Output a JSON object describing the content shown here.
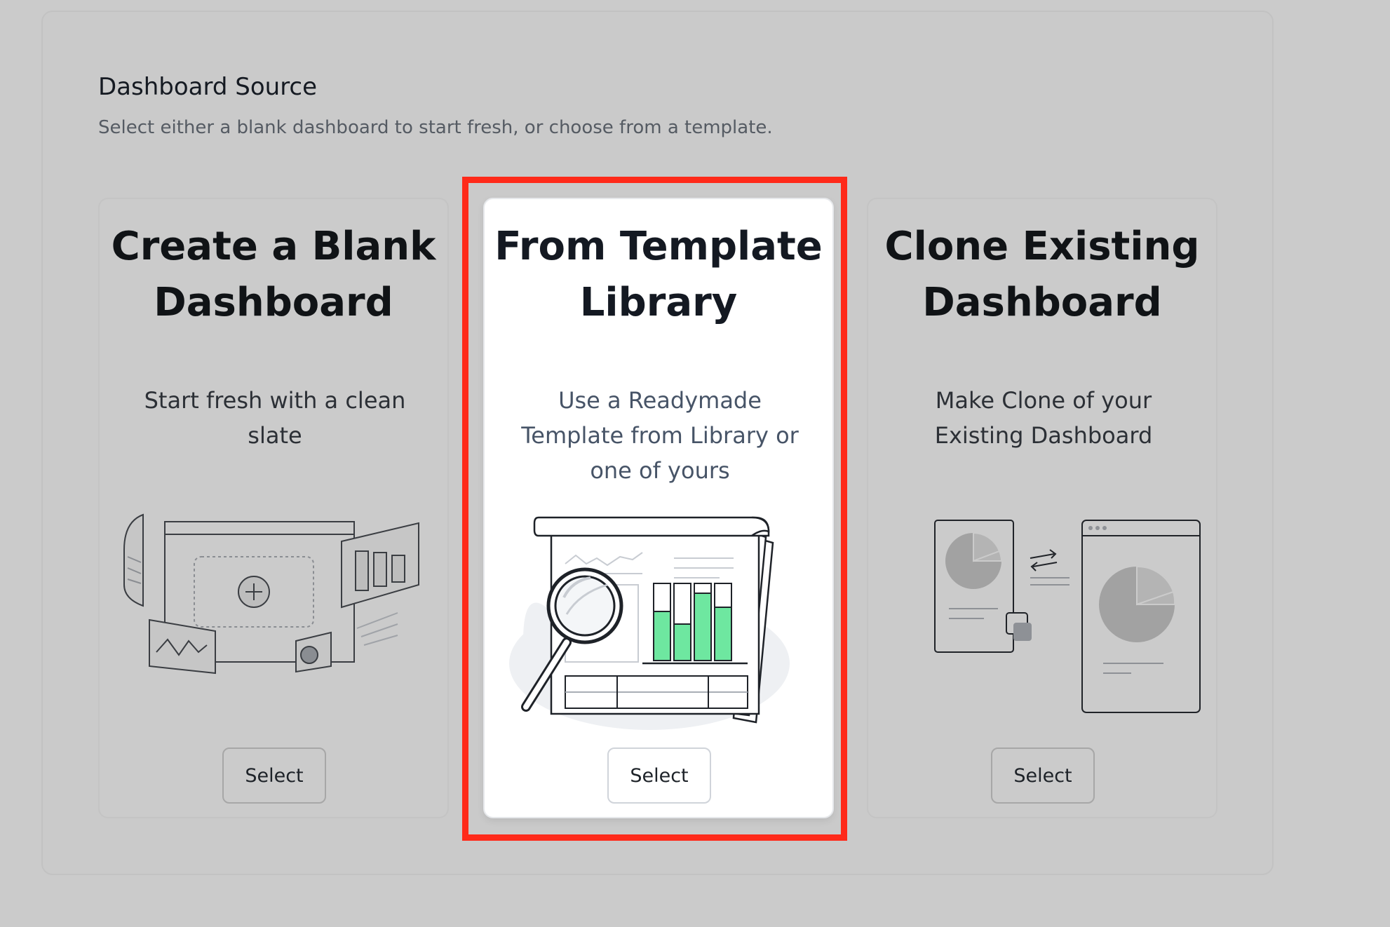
{
  "section": {
    "title": "Dashboard Source",
    "subtitle": "Select either a blank dashboard to start fresh, or choose from a template."
  },
  "cards": [
    {
      "title_line1": "Create a Blank",
      "title_line2": "Dashboard",
      "description": "Start fresh with a clean slate",
      "button_label": "Select",
      "icon": "blank-dashboard-illustration",
      "selected": false
    },
    {
      "title_line1": "From Template",
      "title_line2": "Library",
      "description": "Use a Readymade Template from Library or one of yours",
      "button_label": "Select",
      "icon": "template-library-illustration",
      "selected": true
    },
    {
      "title_line1": "Clone Existing",
      "title_line2": "Dashboard",
      "description": "Make Clone of your Existing Dashboard",
      "button_label": "Select",
      "icon": "clone-dashboard-illustration",
      "selected": false
    }
  ],
  "colors": {
    "highlight": "#ff2a1a",
    "accent_green": "#6ee7a0",
    "backdrop": "#cbcbcb"
  }
}
